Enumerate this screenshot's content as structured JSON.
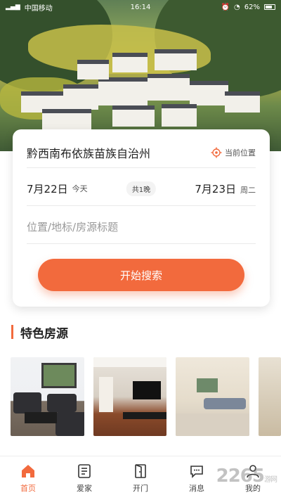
{
  "status_bar": {
    "carrier": "中国移动",
    "time": "16:14",
    "battery": "62%"
  },
  "search_card": {
    "location": "黔西南布依族苗族自治州",
    "current_location_label": "当前位置",
    "check_in_date": "7月22日",
    "check_in_day": "今天",
    "nights": "共1晚",
    "check_out_date": "7月23日",
    "check_out_day": "周二",
    "search_placeholder": "位置/地标/房源标题",
    "search_button": "开始搜索"
  },
  "featured": {
    "title": "特色房源",
    "thumbnails": [
      "living-room",
      "tv-wall",
      "lobby-sofa",
      "partial"
    ]
  },
  "nav": {
    "items": [
      {
        "label": "首页",
        "icon": "home-icon",
        "active": true
      },
      {
        "label": "爱家",
        "icon": "document-icon",
        "active": false
      },
      {
        "label": "开门",
        "icon": "door-icon",
        "active": false
      },
      {
        "label": "消息",
        "icon": "chat-icon",
        "active": false
      },
      {
        "label": "我的",
        "icon": "user-icon",
        "active": false
      }
    ]
  },
  "watermark": {
    "text": "2265",
    "suffix": "游网"
  },
  "colors": {
    "accent": "#f26a3d"
  }
}
